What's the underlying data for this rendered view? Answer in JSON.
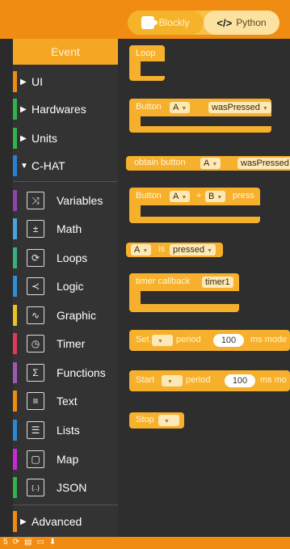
{
  "toggle": {
    "blockly": "Blockly",
    "python": "Python"
  },
  "toolbox": {
    "event": "Event",
    "categories_top": [
      {
        "label": "UI",
        "expanded": false,
        "color": "#f08c12"
      },
      {
        "label": "Hardwares",
        "expanded": false,
        "color": "#2fb34a"
      },
      {
        "label": "Units",
        "expanded": false,
        "color": "#2fb34a"
      },
      {
        "label": "C-HAT",
        "expanded": true,
        "color": "#2a7fd4"
      }
    ],
    "categories": [
      {
        "label": "Variables",
        "icon": "variables-icon",
        "glyph": "⤨",
        "color": "#8e44ad"
      },
      {
        "label": "Math",
        "icon": "math-icon",
        "glyph": "±",
        "color": "#4aa3df"
      },
      {
        "label": "Loops",
        "icon": "loops-icon",
        "glyph": "⟳",
        "color": "#3ab07a"
      },
      {
        "label": "Logic",
        "icon": "logic-icon",
        "glyph": "≺",
        "color": "#2d8fd4"
      },
      {
        "label": "Graphic",
        "icon": "graphic-icon",
        "glyph": "∿",
        "color": "#f0c020"
      },
      {
        "label": "Timer",
        "icon": "timer-icon",
        "glyph": "◷",
        "color": "#e03a5a"
      },
      {
        "label": "Functions",
        "icon": "functions-icon",
        "glyph": "Σ",
        "color": "#9b59b6"
      },
      {
        "label": "Text",
        "icon": "text-icon",
        "glyph": "≡",
        "color": "#f08c12"
      },
      {
        "label": "Lists",
        "icon": "lists-icon",
        "glyph": "☰",
        "color": "#2a8ad4"
      },
      {
        "label": "Map",
        "icon": "map-icon",
        "glyph": "▢",
        "color": "#c72ad4"
      },
      {
        "label": "JSON",
        "icon": "json-icon",
        "glyph": "{..}",
        "color": "#2fb34a"
      }
    ],
    "advanced": "Advanced"
  },
  "blocks": {
    "loop": "Loop",
    "button_pressed": {
      "prefix": "Button",
      "button": "A",
      "event": "wasPressed"
    },
    "obtain_button": {
      "prefix": "obtain button",
      "button": "A",
      "event": "wasPressed"
    },
    "button_combo": {
      "prefix": "Button",
      "a": "A",
      "plus": "+",
      "b": "B",
      "suffix": "press"
    },
    "is_pressed": {
      "button": "A",
      "is": "is",
      "state": "pressed"
    },
    "timer_callback": {
      "prefix": "timer callback",
      "name": "timer1"
    },
    "set_period": {
      "prefix": "Set",
      "mid": "period",
      "value": "100",
      "suffix": "ms mode"
    },
    "start_period": {
      "prefix": "Start",
      "mid": "period",
      "value": "100",
      "suffix": "ms mo"
    },
    "stop": {
      "prefix": "Stop"
    }
  },
  "bottom": {
    "number": "5"
  }
}
